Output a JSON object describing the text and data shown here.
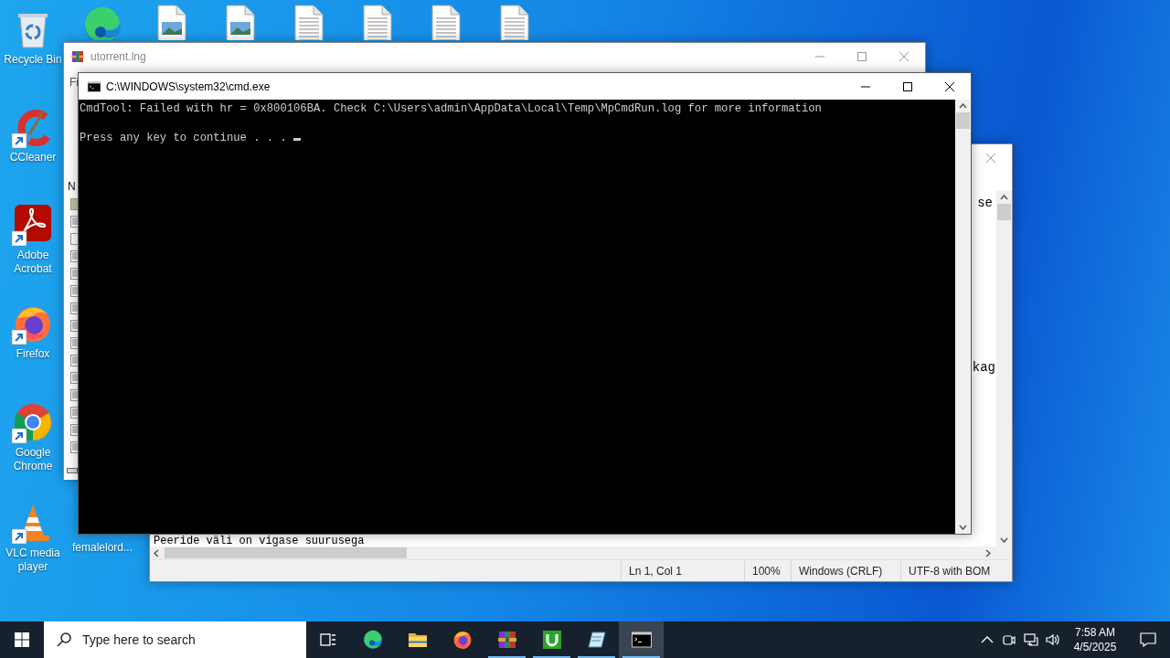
{
  "desktop_icons": [
    {
      "kind": "recycle_bin",
      "label": "Recycle Bin",
      "shortcut": false
    },
    {
      "kind": "ccleaner",
      "label": "CCleaner",
      "shortcut": true
    },
    {
      "kind": "acrobat",
      "label": "Adobe Acrobat",
      "shortcut": true
    },
    {
      "kind": "firefox",
      "label": "Firefox",
      "shortcut": true
    },
    {
      "kind": "chrome",
      "label": "Google Chrome",
      "shortcut": true
    },
    {
      "kind": "vlc",
      "label": "VLC media player",
      "shortcut": true
    },
    {
      "kind": "covered",
      "label": "femalelord..."
    }
  ],
  "top_row_icons": [
    {
      "kind": "edge"
    },
    {
      "kind": "image_file"
    },
    {
      "kind": "image_file"
    },
    {
      "kind": "text_file"
    },
    {
      "kind": "text_file"
    },
    {
      "kind": "text_file"
    },
    {
      "kind": "text_file"
    }
  ],
  "archive_window": {
    "title": "utorrent.lng",
    "menu_fragment": "Fi",
    "column_fragment": "N"
  },
  "editor_window": {
    "line_fragments": [
      "se",
      "kag"
    ],
    "bottom_line": "Peeride väli on vigase suurusega",
    "status": [
      "Ln 1, Col 1",
      "100%",
      "Windows (CRLF)",
      "UTF-8 with BOM"
    ]
  },
  "console_window": {
    "title": "C:\\WINDOWS\\system32\\cmd.exe",
    "lines": [
      "CmdTool: Failed with hr = 0x800106BA. Check C:\\Users\\admin\\AppData\\Local\\Temp\\MpCmdRun.log for more information",
      "Press any key to continue . . . "
    ],
    "cursor": true
  },
  "taskbar": {
    "search_placeholder": "Type here to search",
    "apps": [
      {
        "kind": "edge",
        "running": false,
        "selected": false
      },
      {
        "kind": "explorer",
        "running": false,
        "selected": false
      },
      {
        "kind": "firefox",
        "running": false,
        "selected": false
      },
      {
        "kind": "winrar",
        "running": true,
        "selected": false
      },
      {
        "kind": "utorrent",
        "running": true,
        "selected": false
      },
      {
        "kind": "notepad",
        "running": true,
        "selected": false
      },
      {
        "kind": "cmd",
        "running": true,
        "selected": true
      }
    ],
    "time": "7:58 AM",
    "date": "4/5/2025"
  }
}
